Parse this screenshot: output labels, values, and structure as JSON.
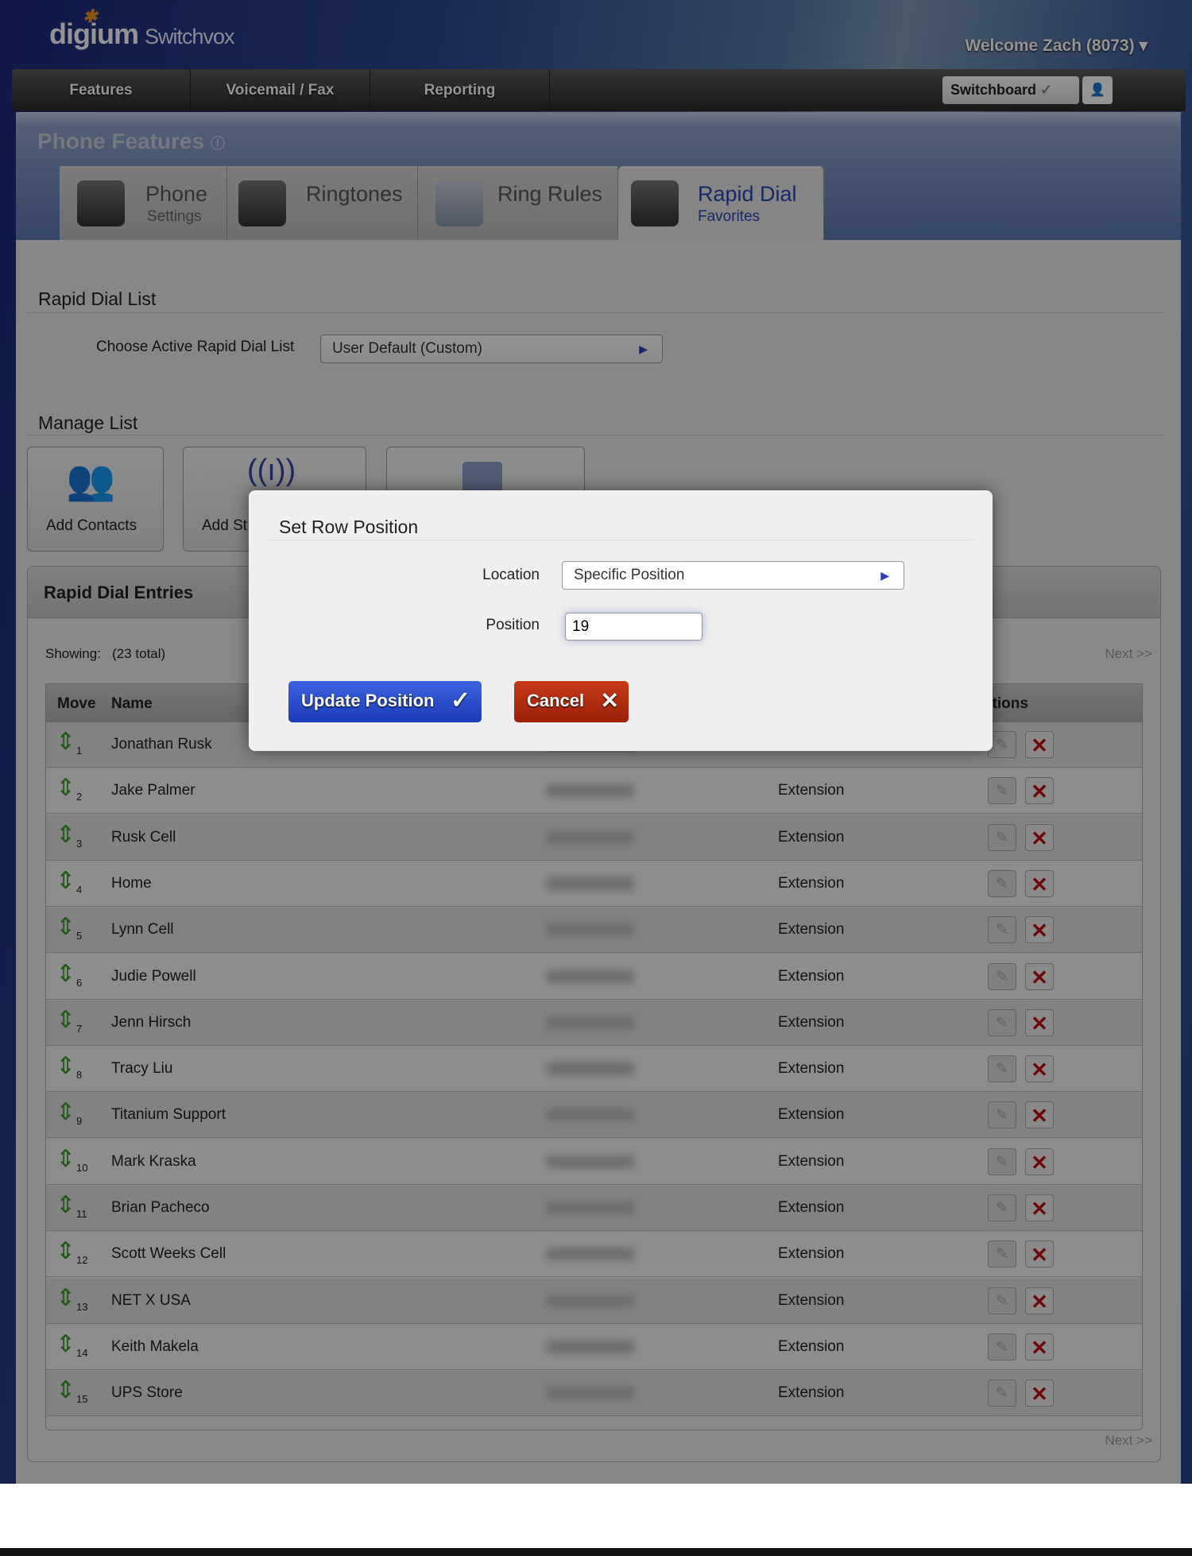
{
  "header": {
    "logo": "digium",
    "product": "Switchvox",
    "welcome": "Welcome Zach (8073)"
  },
  "nav": {
    "items": [
      "Features",
      "Voicemail / Fax",
      "Reporting"
    ],
    "switchboard": "Switchboard"
  },
  "page_title": "Phone Features",
  "tabs": [
    {
      "label": "Phone",
      "sub": "Settings"
    },
    {
      "label": "Ringtones",
      "sub": ""
    },
    {
      "label": "Ring Rules",
      "sub": ""
    },
    {
      "label": "Rapid Dial",
      "sub": "Favorites",
      "active": true
    }
  ],
  "rapid_dial_list": {
    "heading": "Rapid Dial List",
    "choose_label": "Choose Active Rapid Dial List",
    "selected": "User Default (Custom)"
  },
  "manage": {
    "heading": "Manage List",
    "buttons": [
      "Add Contacts",
      "Add St",
      ""
    ]
  },
  "entries": {
    "heading": "Rapid Dial Entries",
    "showing": "Showing:",
    "total": "(23 total)",
    "next": "Next >>",
    "columns": [
      "Move",
      "Name",
      "",
      "",
      "ctions"
    ],
    "rows": [
      {
        "n": "1",
        "name": "Jonathan Rusk",
        "type": ""
      },
      {
        "n": "2",
        "name": "Jake Palmer",
        "type": "Extension"
      },
      {
        "n": "3",
        "name": "Rusk Cell",
        "type": "Extension"
      },
      {
        "n": "4",
        "name": "Home",
        "type": "Extension"
      },
      {
        "n": "5",
        "name": "Lynn Cell",
        "type": "Extension"
      },
      {
        "n": "6",
        "name": "Judie Powell",
        "type": "Extension"
      },
      {
        "n": "7",
        "name": "Jenn Hirsch",
        "type": "Extension"
      },
      {
        "n": "8",
        "name": "Tracy Liu",
        "type": "Extension"
      },
      {
        "n": "9",
        "name": "Titanium Support",
        "type": "Extension"
      },
      {
        "n": "10",
        "name": "Mark Kraska",
        "type": "Extension"
      },
      {
        "n": "11",
        "name": "Brian Pacheco",
        "type": "Extension"
      },
      {
        "n": "12",
        "name": "Scott Weeks Cell",
        "type": "Extension"
      },
      {
        "n": "13",
        "name": "NET X USA",
        "type": "Extension"
      },
      {
        "n": "14",
        "name": "Keith Makela",
        "type": "Extension"
      },
      {
        "n": "15",
        "name": "UPS Store",
        "type": "Extension"
      }
    ]
  },
  "modal": {
    "title": "Set Row Position",
    "location_label": "Location",
    "location_value": "Specific Position",
    "position_label": "Position",
    "position_value": "19",
    "update": "Update Position",
    "cancel": "Cancel"
  },
  "colors": {
    "accent": "#2a46b0",
    "update": "#2a4fd0",
    "cancel": "#b52a10"
  }
}
